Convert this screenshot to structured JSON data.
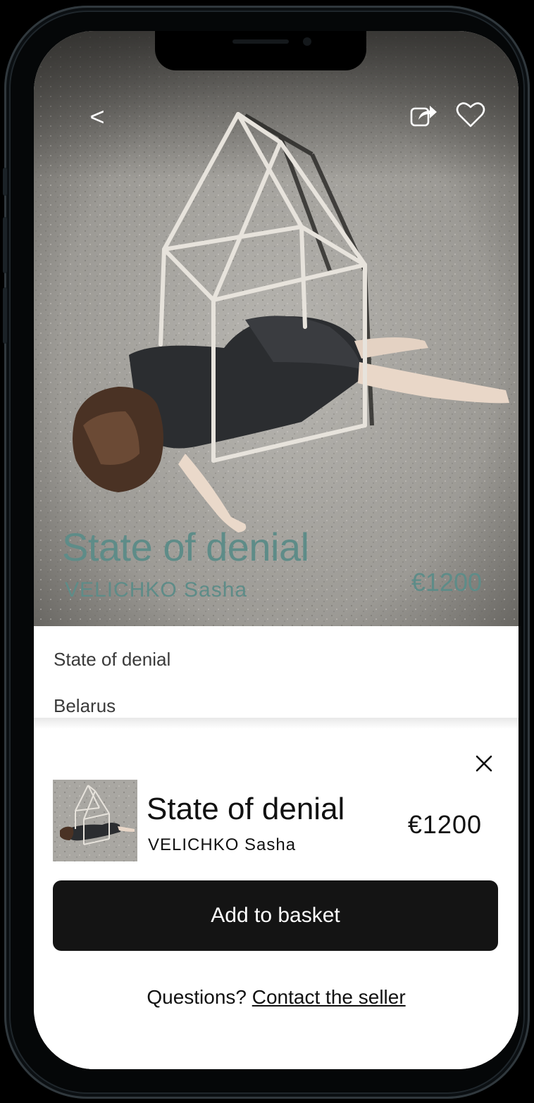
{
  "nav": {
    "back_icon": "<",
    "share_icon": "share-icon",
    "favorite_icon": "heart-icon"
  },
  "hero": {
    "title": "State of denial",
    "artist": "VELICHKO Sasha",
    "price": "€1200",
    "accent_color": "#5e8c88"
  },
  "details": {
    "title": "State of denial",
    "country": "Belarus"
  },
  "purchase": {
    "close_icon": "close-icon",
    "title": "State of denial",
    "artist": "VELICHKO Sasha",
    "price": "€1200",
    "add_button_label": "Add to basket",
    "questions_text": "Questions?",
    "contact_link_label": "Contact the seller"
  },
  "colors": {
    "button_bg": "#141414",
    "text": "#111111"
  }
}
